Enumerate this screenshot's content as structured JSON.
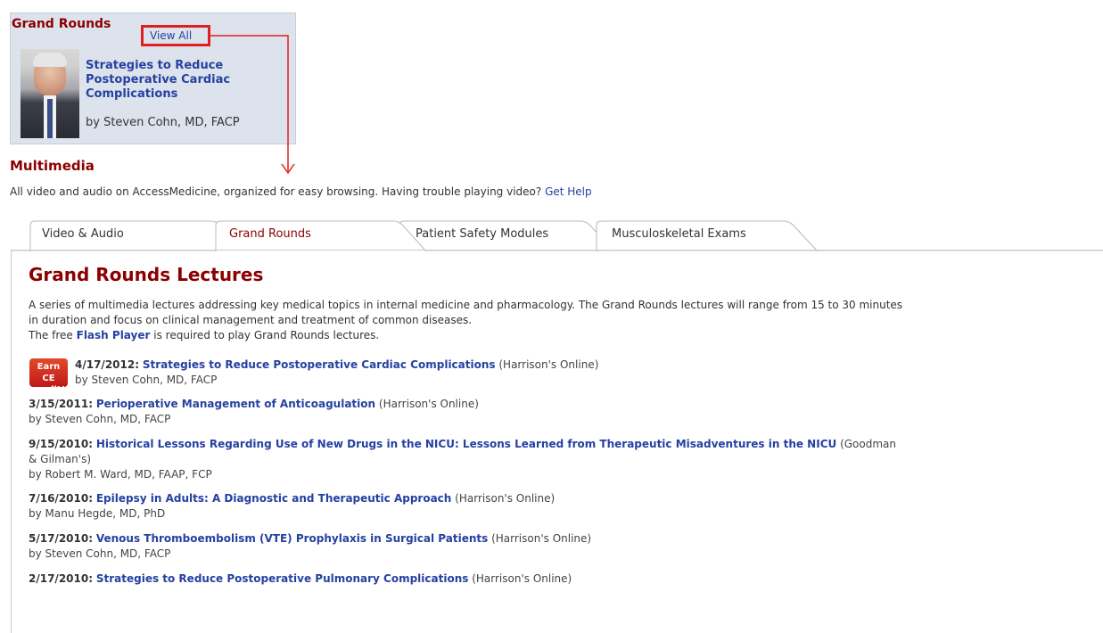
{
  "grand_rounds_box": {
    "title": "Grand Rounds",
    "view_all": "View All",
    "feature_title": "Strategies to Reduce Postoperative Cardiac Complications",
    "feature_author": "by Steven Cohn, MD, FACP"
  },
  "multimedia": {
    "title": "Multimedia",
    "description": "All video and audio on AccessMedicine, organized for easy browsing. Having trouble playing video?",
    "help_link": "Get Help"
  },
  "tabs": [
    {
      "label": "Video & Audio",
      "active": false
    },
    {
      "label": "Grand Rounds",
      "active": true
    },
    {
      "label": "Patient Safety Modules",
      "active": false
    },
    {
      "label": "Musculoskeletal Exams",
      "active": false
    }
  ],
  "content": {
    "title": "Grand Rounds Lectures",
    "intro_line1": "A series of multimedia lectures addressing key medical topics in internal medicine and pharmacology. The Grand Rounds lectures will range from 15 to 30 minutes",
    "intro_line2": "in duration and focus on clinical management and treatment of common diseases.",
    "intro_line3_pre": "The free",
    "intro_flash_link": "Flash Player",
    "intro_line3_post": "is required to play Grand Rounds lectures.",
    "ce_badge_line1": "Earn CE",
    "ce_badge_line2": "credit!"
  },
  "lectures": [
    {
      "date": "4/17/2012:",
      "title": "Strategies to Reduce Postoperative Cardiac Complications",
      "source": "(Harrison's Online)",
      "author": "by Steven Cohn, MD, FACP"
    },
    {
      "date": "3/15/2011:",
      "title": "Perioperative Management of Anticoagulation",
      "source": "(Harrison's Online)",
      "author": "by Steven Cohn, MD, FACP"
    },
    {
      "date": "9/15/2010:",
      "title": "Historical Lessons Regarding Use of New Drugs in the NICU: Lessons Learned from Therapeutic Misadventures in the NICU",
      "source": "(Goodman",
      "source_cont": "& Gilman's)",
      "author": "by Robert M. Ward, MD, FAAP, FCP"
    },
    {
      "date": "7/16/2010:",
      "title": "Epilepsy in Adults: A Diagnostic and Therapeutic Approach",
      "source": "(Harrison's Online)",
      "author": "by Manu Hegde, MD, PhD"
    },
    {
      "date": "5/17/2010:",
      "title": "Venous Thromboembolism (VTE) Prophylaxis in Surgical Patients",
      "source": "(Harrison's Online)",
      "author": "by Steven Cohn, MD, FACP"
    },
    {
      "date": "2/17/2010:",
      "title": "Strategies to Reduce Postoperative Pulmonary Complications",
      "source": "(Harrison's Online)",
      "author": ""
    }
  ],
  "colors": {
    "heading": "#8b0000",
    "link": "#2541a1",
    "box_bg": "#dde3ec",
    "highlight": "#e02020"
  }
}
